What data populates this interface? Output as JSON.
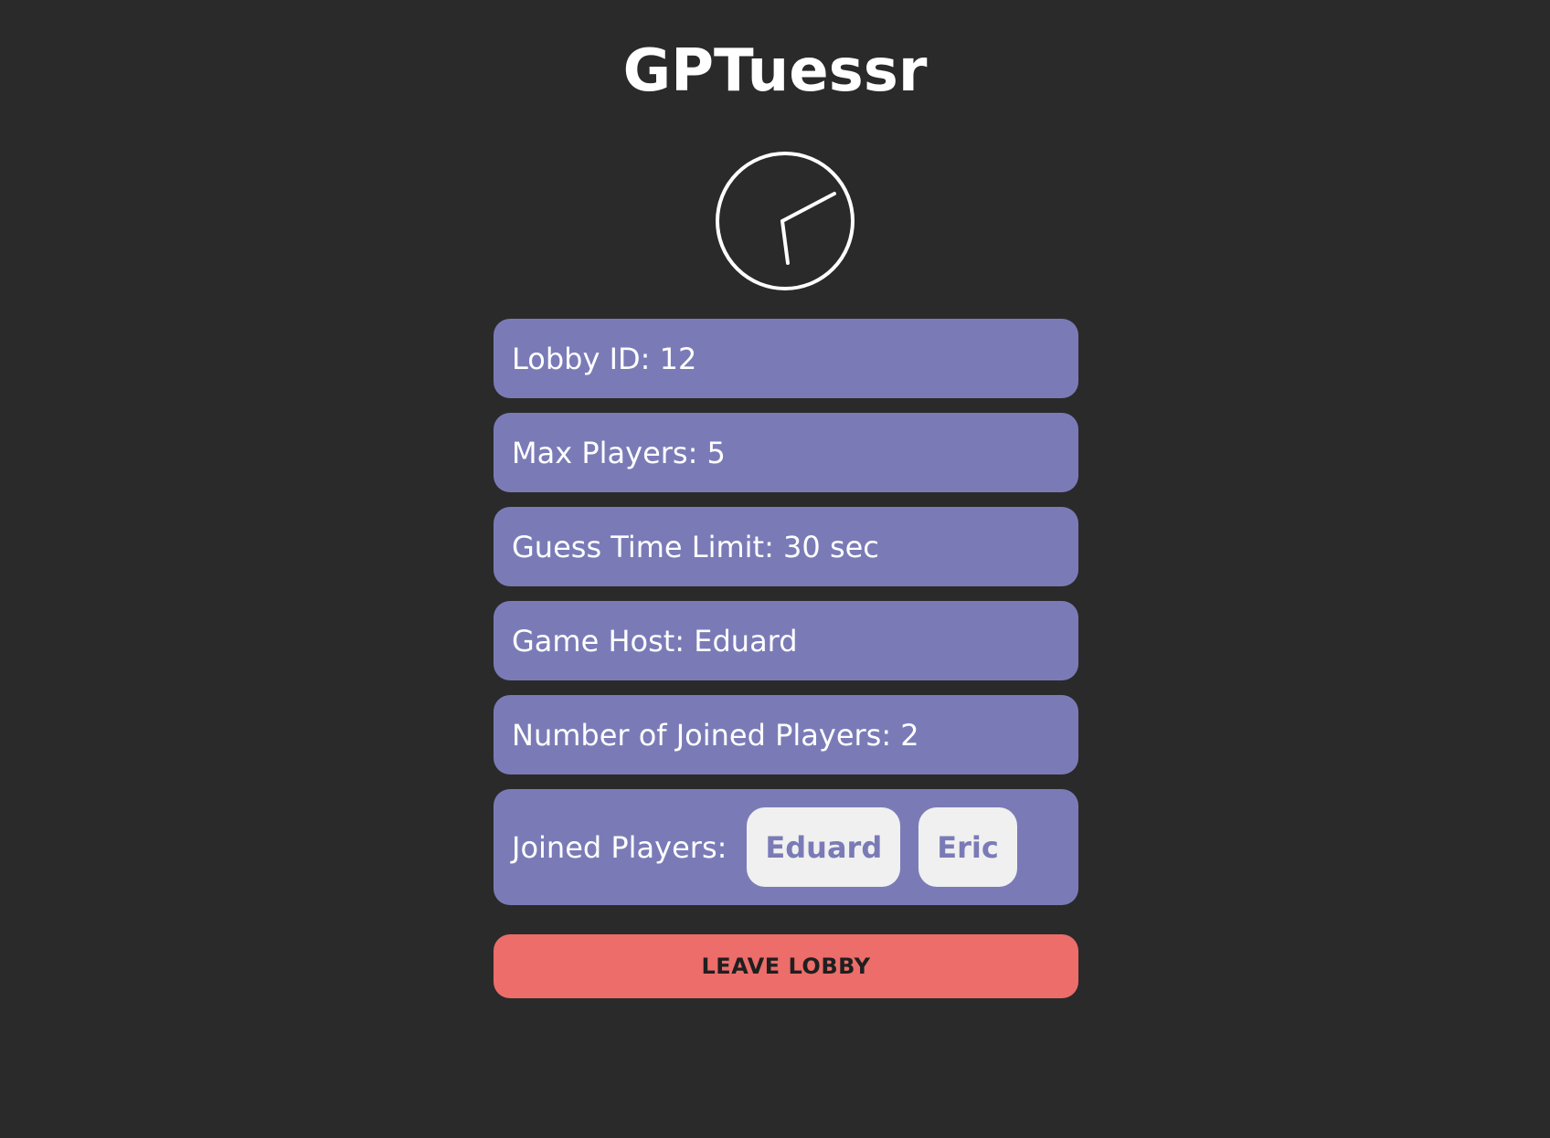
{
  "app": {
    "title": "GPTuessr"
  },
  "icon": {
    "timer": "clock-icon"
  },
  "lobby": {
    "lobby_id": "Lobby ID: 12",
    "max_players": "Max Players: 5",
    "guess_time_limit": "Guess Time Limit: 30 sec",
    "game_host": "Game Host: Eduard",
    "joined_count": "Number of Joined Players: 2",
    "joined_players_label": "Joined Players:",
    "players": [
      "Eduard",
      "Eric"
    ]
  },
  "actions": {
    "leave_label": "LEAVE LOBBY"
  },
  "colors": {
    "background": "#2a2a2a",
    "panel": "#7a7bb6",
    "chip": "#f0f0f0",
    "leave_button": "#ec6d6a"
  }
}
